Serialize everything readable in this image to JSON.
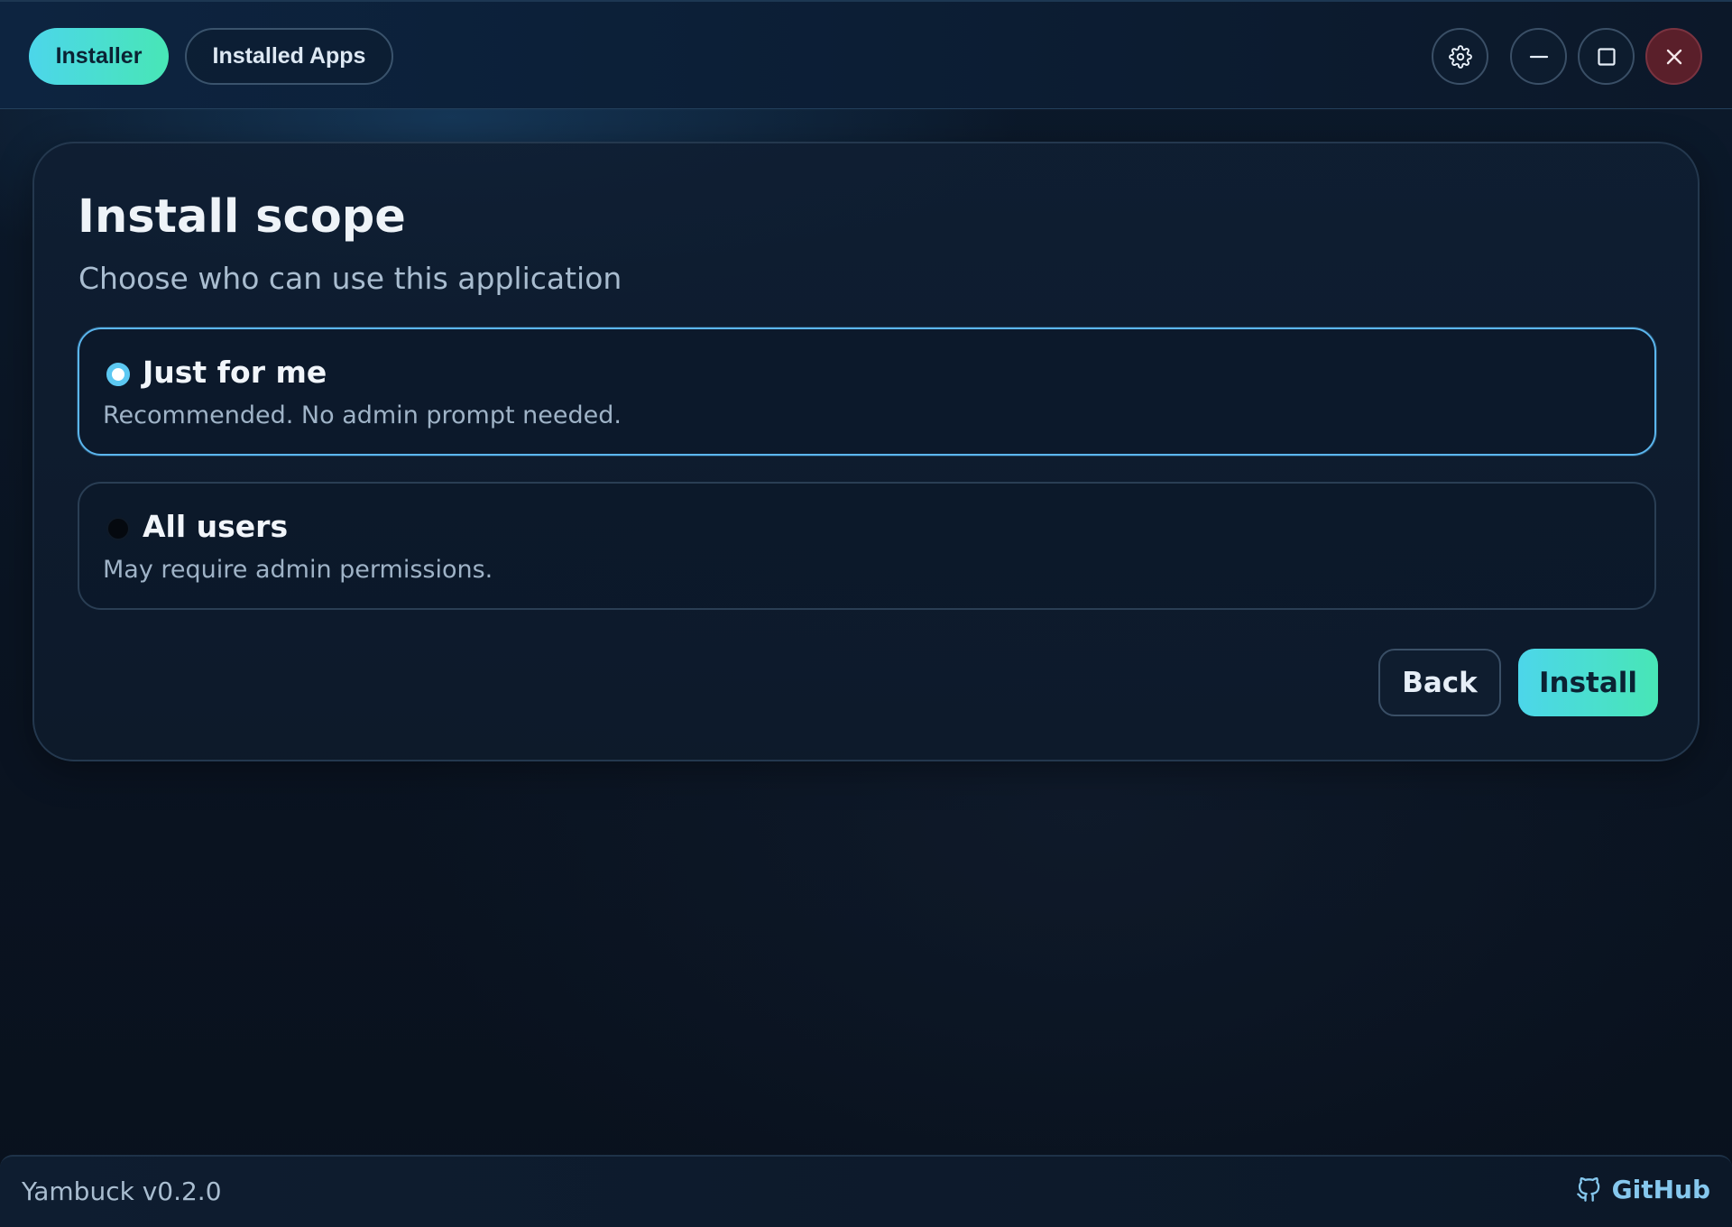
{
  "header": {
    "tabs": [
      {
        "label": "Installer",
        "active": true
      },
      {
        "label": "Installed Apps",
        "active": false
      }
    ],
    "icons": {
      "settings": "gear-icon",
      "minimize": "minimize-icon",
      "maximize": "maximize-icon",
      "close": "close-icon"
    }
  },
  "card": {
    "title": "Install scope",
    "subtitle": "Choose who can use this application",
    "options": [
      {
        "label": "Just for me",
        "description": "Recommended. No admin prompt needed.",
        "selected": true
      },
      {
        "label": "All users",
        "description": "May require admin permissions.",
        "selected": false
      }
    ],
    "back_label": "Back",
    "install_label": "Install"
  },
  "footer": {
    "version": "Yambuck v0.2.0",
    "github_label": "GitHub",
    "github_icon": "github-icon"
  },
  "colors": {
    "accent_start": "#4cd6ea",
    "accent_end": "#48e6b6",
    "selected_border": "#5bb6ee",
    "close_bg": "#5a1f2a",
    "link": "#86c8ee"
  }
}
